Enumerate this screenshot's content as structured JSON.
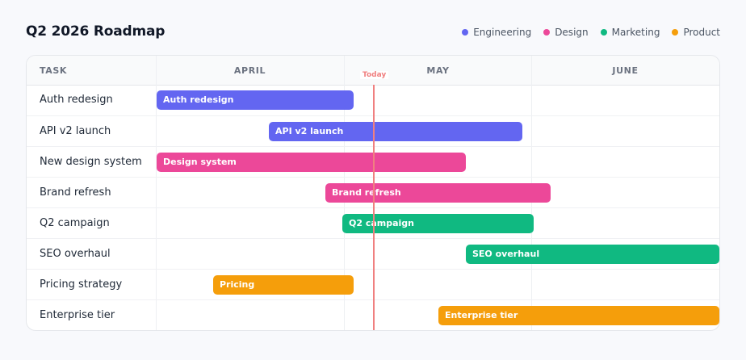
{
  "title": "Q2 2026 Roadmap",
  "legend": [
    {
      "label": "Engineering",
      "color": "#6366f1"
    },
    {
      "label": "Design",
      "color": "#ec4899"
    },
    {
      "label": "Marketing",
      "color": "#10b981"
    },
    {
      "label": "Product",
      "color": "#f59e0b"
    }
  ],
  "header": {
    "task": "TASK",
    "months": [
      "APRIL",
      "MAY",
      "JUNE"
    ]
  },
  "today": {
    "label": "Today"
  },
  "rows": [
    {
      "task": "Auth redesign",
      "bar_label": "Auth redesign",
      "category": "Engineering",
      "color": "#6366f1"
    },
    {
      "task": "API v2 launch",
      "bar_label": "API v2 launch",
      "category": "Engineering",
      "color": "#6366f1"
    },
    {
      "task": "New design system",
      "bar_label": "Design system",
      "category": "Design",
      "color": "#ec4899"
    },
    {
      "task": "Brand refresh",
      "bar_label": "Brand refresh",
      "category": "Design",
      "color": "#ec4899"
    },
    {
      "task": "Q2 campaign",
      "bar_label": "Q2 campaign",
      "category": "Marketing",
      "color": "#10b981"
    },
    {
      "task": "SEO overhaul",
      "bar_label": "SEO overhaul",
      "category": "Marketing",
      "color": "#10b981"
    },
    {
      "task": "Pricing strategy",
      "bar_label": "Pricing",
      "category": "Product",
      "color": "#f59e0b"
    },
    {
      "task": "Enterprise tier",
      "bar_label": "Enterprise tier",
      "category": "Product",
      "color": "#f59e0b"
    }
  ]
}
